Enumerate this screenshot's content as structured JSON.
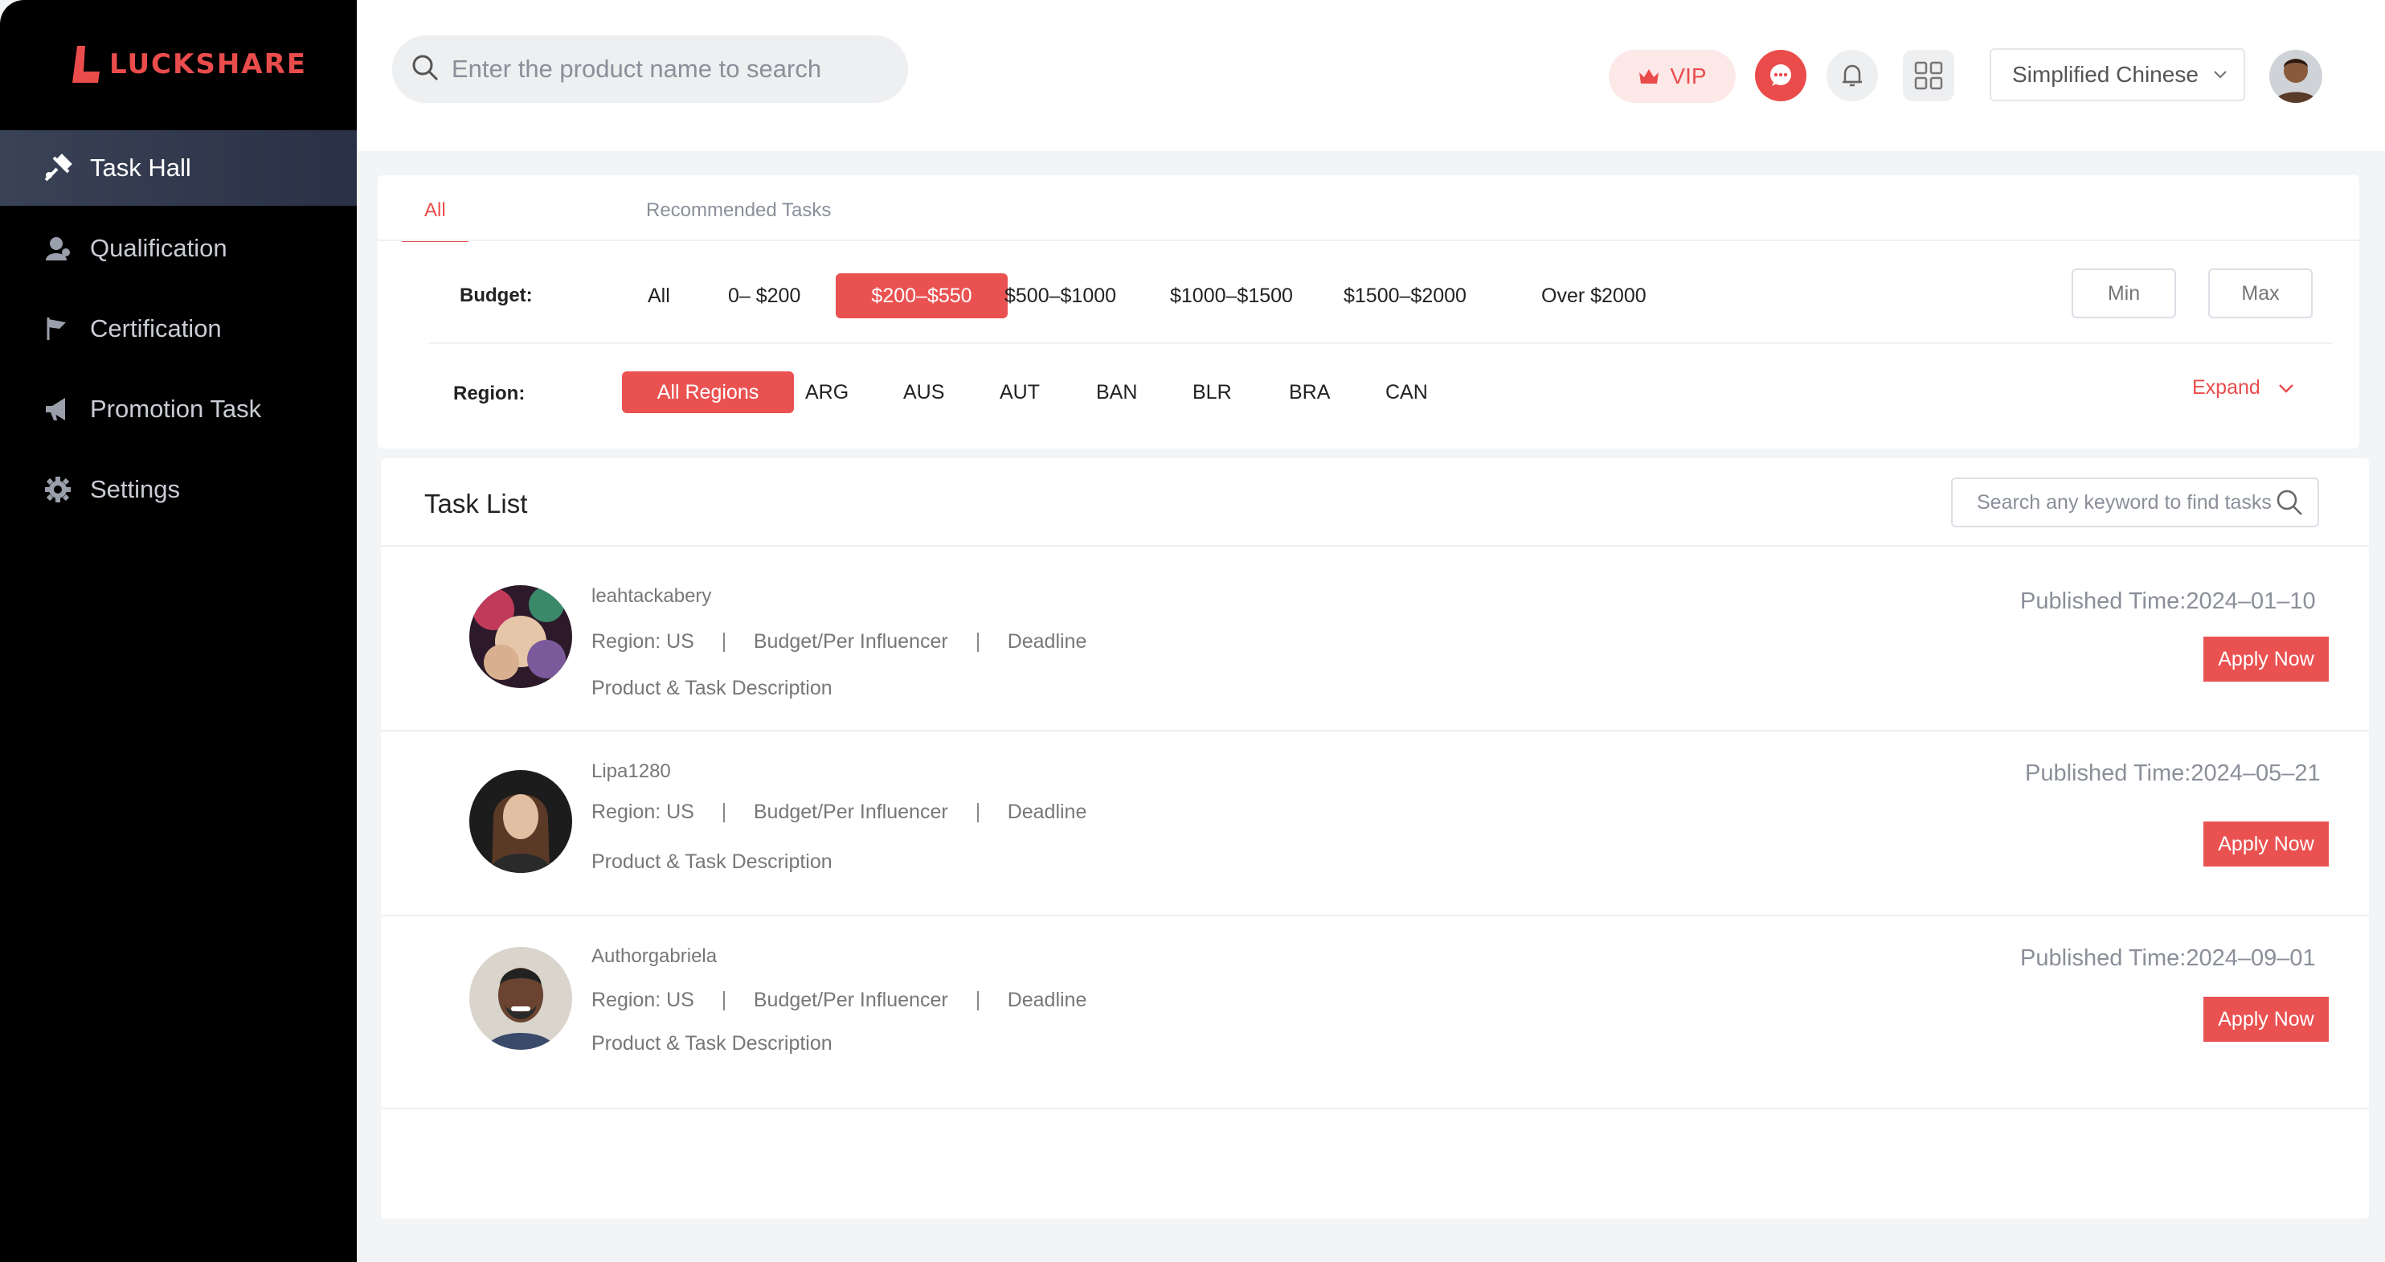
{
  "brand": {
    "name": "LUCKSHARE",
    "color": "#ea4c4c"
  },
  "sidebar": {
    "items": [
      {
        "label": "Task Hall",
        "icon": "task-hall-icon",
        "active": true
      },
      {
        "label": "Qualification",
        "icon": "user-icon"
      },
      {
        "label": "Certification",
        "icon": "flag-icon"
      },
      {
        "label": "Promotion Task",
        "icon": "megaphone-icon"
      },
      {
        "label": "Settings",
        "icon": "gear-icon"
      }
    ]
  },
  "header": {
    "search_placeholder": "Enter the product name to search",
    "vip_label": "VIP",
    "language": "Simplified Chinese"
  },
  "filters": {
    "tabs": [
      {
        "label": "All",
        "active": true
      },
      {
        "label": "Recommended Tasks"
      }
    ],
    "budget_label": "Budget:",
    "budget_options": [
      "All",
      "0– $200",
      "$200–$550",
      "$500–$1000",
      "$1000–$1500",
      "$1500–$2000",
      "Over $2000"
    ],
    "budget_selected": "$200–$550",
    "min_placeholder": "Min",
    "max_placeholder": "Max",
    "region_label": "Region:",
    "region_options": [
      "All Regions",
      "ARG",
      "AUS",
      "AUT",
      "BAN",
      "BLR",
      "BRA",
      "CAN"
    ],
    "region_selected": "All Regions",
    "expand_label": "Expand"
  },
  "task_list": {
    "title": "Task List",
    "search_placeholder": "Search any keyword to find tasks",
    "tasks": [
      {
        "user": "leahtackabery",
        "region": "Region: US",
        "budget": "Budget/Per Influencer",
        "deadline": "Deadline",
        "description": "Product & Task Description",
        "published": "Published Time:2024–01–10",
        "action": "Apply Now"
      },
      {
        "user": "Lipa1280",
        "region": "Region: US",
        "budget": "Budget/Per Influencer",
        "deadline": "Deadline",
        "description": "Product & Task Description",
        "published": "Published Time:2024–05–21",
        "action": "Apply Now"
      },
      {
        "user": "Authorgabriela",
        "region": "Region: US",
        "budget": "Budget/Per Influencer",
        "deadline": "Deadline",
        "description": "Product & Task Description",
        "published": "Published Time:2024–09–01",
        "action": "Apply Now"
      }
    ]
  },
  "colors": {
    "accent": "#ea5252",
    "sidebar_bg": "#000000",
    "active_nav": "#333b50"
  }
}
